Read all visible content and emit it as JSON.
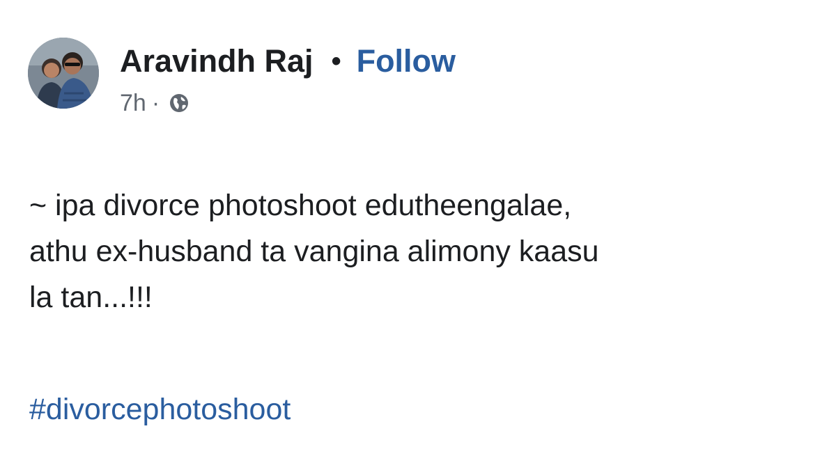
{
  "post": {
    "author_name": "Aravindh Raj",
    "separator": "•",
    "follow_label": "Follow",
    "timestamp": "7h",
    "meta_separator": "·",
    "audience_icon": "globe-icon",
    "body_lines": [
      "~ ipa divorce photoshoot edutheengalae,",
      "athu ex-husband ta vangina alimony kaasu",
      "la tan...!!!"
    ],
    "hashtag": "#divorcephotoshoot"
  },
  "colors": {
    "text": "#1c1e21",
    "link": "#2a5d9f",
    "muted": "#606770",
    "background": "#ffffff"
  }
}
